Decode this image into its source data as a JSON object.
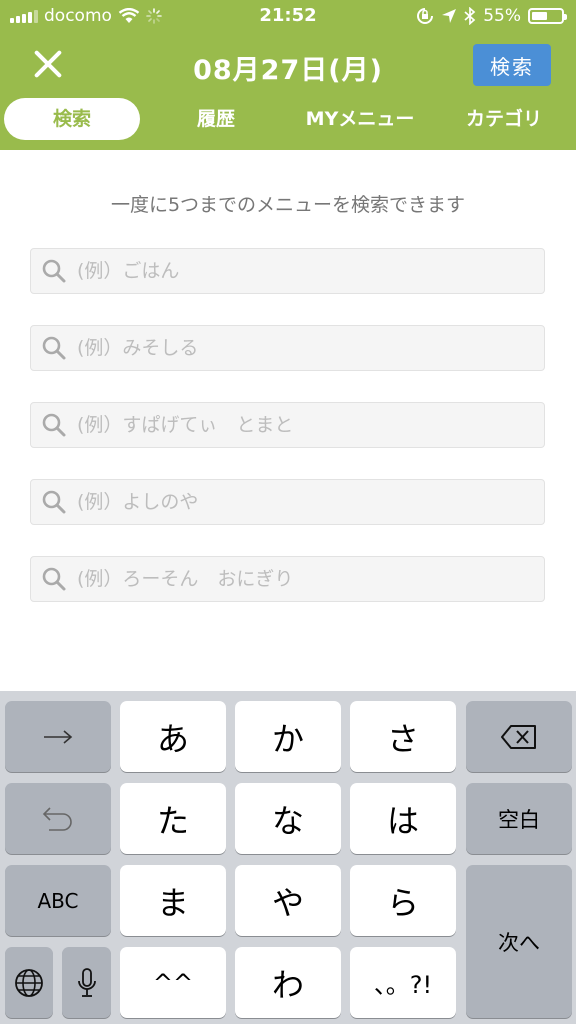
{
  "status_bar": {
    "carrier": "docomo",
    "time": "21:52",
    "battery": "55%"
  },
  "header": {
    "date": "08月27日(月)",
    "search_button": "検索",
    "tabs": [
      {
        "label": "検索",
        "active": true
      },
      {
        "label": "履歴",
        "active": false
      },
      {
        "label": "MYメニュー",
        "active": false
      },
      {
        "label": "カテゴリ",
        "active": false
      }
    ]
  },
  "main": {
    "hint": "一度に5つまでのメニューを検索できます",
    "fields": [
      {
        "placeholder": "(例）ごはん",
        "value": ""
      },
      {
        "placeholder": "(例）みそしる",
        "value": ""
      },
      {
        "placeholder": "(例）すぱげてぃ　とまと",
        "value": ""
      },
      {
        "placeholder": "(例）よしのや",
        "value": ""
      },
      {
        "placeholder": "(例）ろーそん　おにぎり",
        "value": ""
      }
    ]
  },
  "keyboard": {
    "keys": {
      "a": "あ",
      "ka": "か",
      "sa": "さ",
      "ta": "た",
      "na": "な",
      "ha": "は",
      "ma": "ま",
      "ya": "や",
      "ra": "ら",
      "emoticon": "^^",
      "wa": "わ",
      "punct": "、。?!",
      "space": "空白",
      "abc": "ABC",
      "next": "次へ"
    }
  },
  "icons": {
    "close": "close-icon",
    "search": "search-icon",
    "wifi": "wifi-icon",
    "bluetooth": "bluetooth-icon",
    "location": "location-arrow-icon",
    "globe": "globe-icon",
    "mic": "microphone-icon",
    "backspace": "backspace-icon",
    "undo": "undo-icon",
    "arrow": "right-arrow-icon"
  },
  "colors": {
    "header_green": "#99bb4c",
    "search_blue": "#4b8fd6"
  }
}
